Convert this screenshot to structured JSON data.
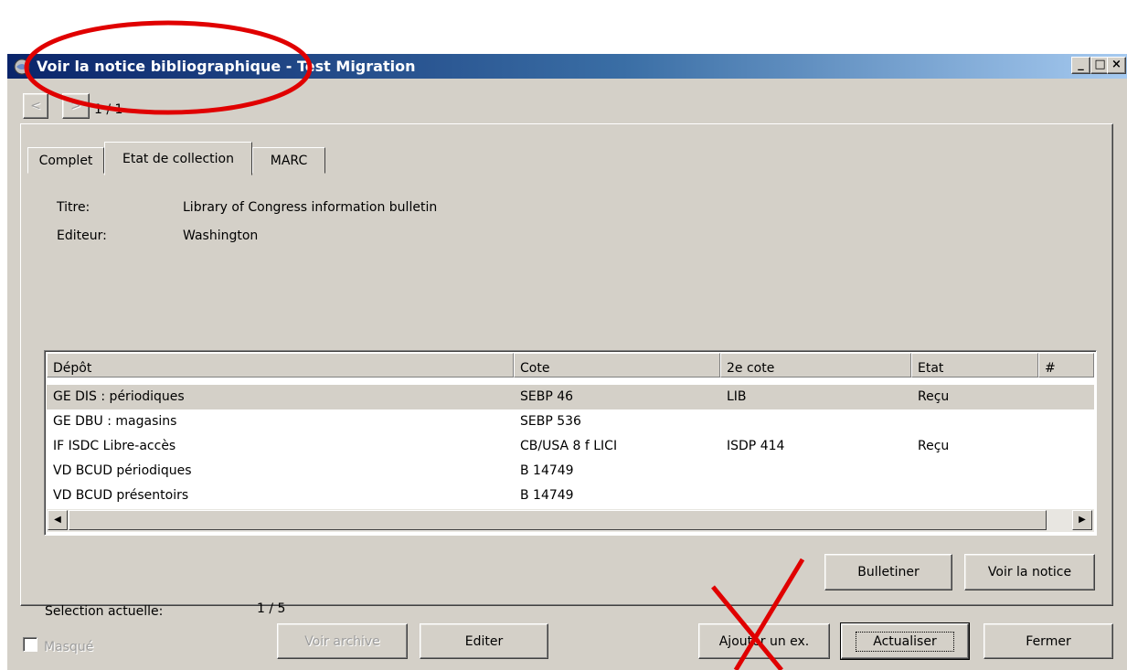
{
  "window": {
    "title": "Voir la notice bibliographique - Test Migration",
    "controls": {
      "minimize": "_",
      "maximize": "□",
      "close": "×"
    }
  },
  "navigation": {
    "prev": "<",
    "next": ">",
    "position": "1 / 1"
  },
  "tabs": [
    {
      "label": "Complet",
      "active": false
    },
    {
      "label": "Etat de collection",
      "active": true
    },
    {
      "label": "MARC",
      "active": false
    }
  ],
  "record": {
    "title_label": "Titre:",
    "title_value": "Library of Congress information bulletin",
    "publisher_label": "Editeur:",
    "publisher_value": "Washington"
  },
  "holdings_table": {
    "columns": [
      "Dépôt",
      "Cote",
      "2e cote",
      "Etat",
      "#"
    ],
    "rows": [
      {
        "depot": "GE DIS : périodiques",
        "cote": "SEBP 46",
        "cote2": "LIB",
        "etat": "Reçu",
        "selected": true
      },
      {
        "depot": "GE DBU : magasins",
        "cote": "SEBP 536",
        "cote2": "",
        "etat": "",
        "selected": false
      },
      {
        "depot": "IF ISDC Libre-accès",
        "cote": "CB/USA 8 f LICI",
        "cote2": "ISDP 414",
        "etat": "Reçu",
        "selected": false
      },
      {
        "depot": "VD BCUD périodiques",
        "cote": "B 14749",
        "cote2": "",
        "etat": "",
        "selected": false
      },
      {
        "depot": "VD BCUD présentoirs",
        "cote": "B 14749",
        "cote2": "",
        "etat": "",
        "selected": false
      }
    ]
  },
  "selection": {
    "label": "Selection actuelle:",
    "value": "1 / 5"
  },
  "panel_buttons": {
    "bulletiner": "Bulletiner",
    "voir_notice": "Voir la notice"
  },
  "footer": {
    "masque_label": "Masqué",
    "voir_archive": "Voir archive",
    "editer": "Editer",
    "ajouter_ex": "Ajouter un ex.",
    "actualiser": "Actualiser",
    "fermer": "Fermer"
  },
  "annotations": {
    "ellipse_color": "#e00000",
    "cross_color": "#e00000"
  }
}
